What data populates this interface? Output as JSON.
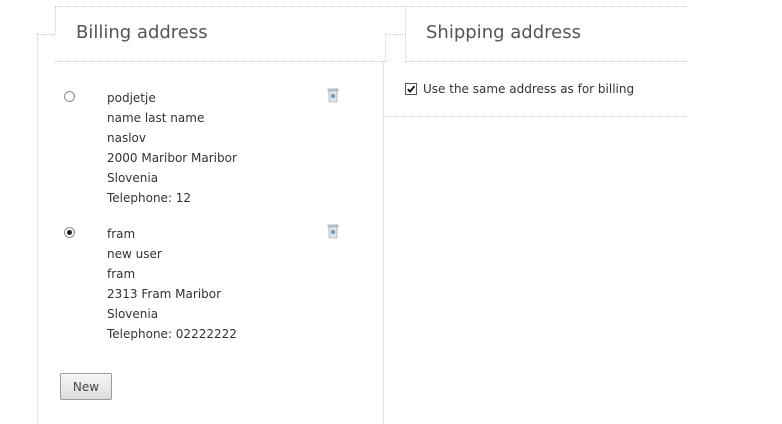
{
  "billing": {
    "title": "Billing address",
    "addresses": [
      {
        "selected": false,
        "lines": [
          "podjetje",
          "name last name",
          "naslov",
          "2000 Maribor Maribor",
          "Slovenia",
          "Telephone: 12"
        ],
        "delete_icon": "trash-icon"
      },
      {
        "selected": true,
        "lines": [
          "fram",
          "new user",
          "fram",
          "2313 Fram Maribor",
          "Slovenia",
          "Telephone: 02222222"
        ],
        "delete_icon": "trash-icon"
      }
    ],
    "new_button_label": "New"
  },
  "shipping": {
    "title": "Shipping address",
    "same_as_billing_label": "Use the same address as for billing",
    "same_as_billing_checked": true
  }
}
